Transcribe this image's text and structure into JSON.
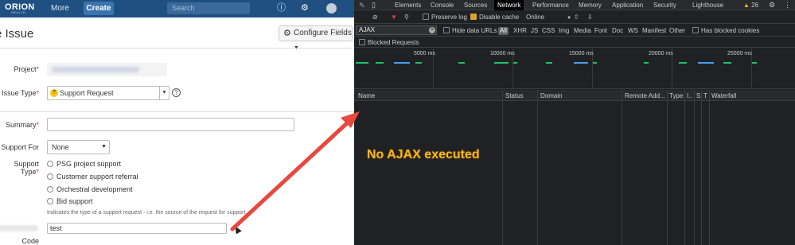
{
  "left": {
    "topbar": {
      "logo": "ORION",
      "logo_sub": "HEALTH",
      "more": "More",
      "create": "Create",
      "search_placeholder": "Search"
    },
    "header": {
      "title": "e Issue",
      "configure": "Configure Fields"
    },
    "form": {
      "project_label": "Project",
      "issue_type_label": "Issue Type",
      "issue_type_value": "Support Request",
      "summary_label": "Summary",
      "support_for_label": "Support For",
      "support_for_value": "None",
      "support_type_label": "Support Type",
      "support_type_options": [
        "PSG project support",
        "Customer support referral",
        "Orchestral development",
        "Bid support"
      ],
      "hint": "Indicates the type of a support request - i.e. the source of the request for support.",
      "code_value": "test",
      "code_label": "Code"
    }
  },
  "devtools": {
    "tabs": [
      "Elements",
      "Console",
      "Sources",
      "Network",
      "Performance",
      "Memory",
      "Application",
      "Security",
      "Lighthouse"
    ],
    "active_tab": "Network",
    "warnings": "26",
    "toolbar": {
      "preserve_log": "Preserve log",
      "disable_cache": "Disable cache",
      "throttle": "Online"
    },
    "filter": {
      "value": "AJAX",
      "hide_data_urls": "Hide data URLs",
      "types": [
        "All",
        "XHR",
        "JS",
        "CSS",
        "Img",
        "Media",
        "Font",
        "Doc",
        "WS",
        "Manifest",
        "Other"
      ],
      "has_blocked_cookies": "Has blocked cookies",
      "blocked_requests": "Blocked Requests"
    },
    "timeline_ticks": [
      "5000 ms",
      "10000 ms",
      "15000 ms",
      "20000 ms",
      "25000 ms"
    ],
    "columns": [
      "Name",
      "Status",
      "Domain",
      "Remote Add...",
      "Type",
      "I..",
      "S",
      "T",
      "Waterfall"
    ]
  },
  "annotation": "No AJAX executed"
}
